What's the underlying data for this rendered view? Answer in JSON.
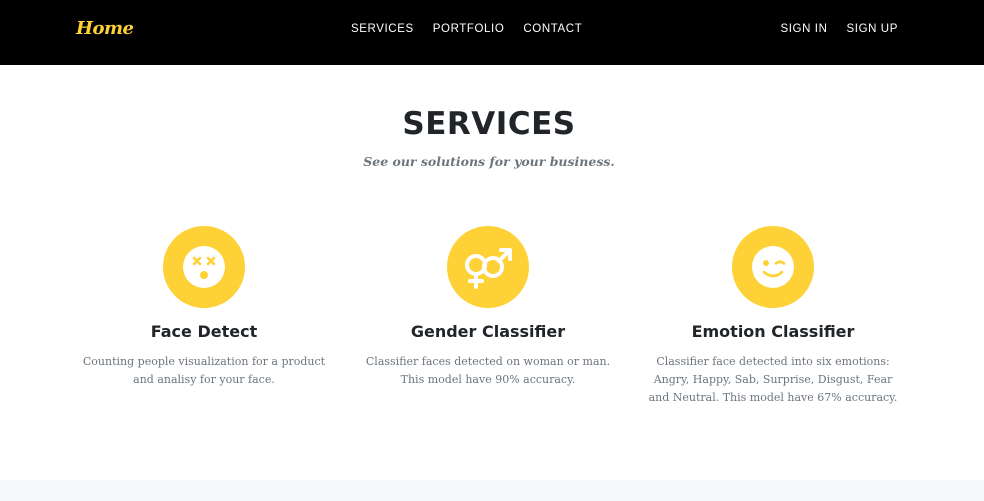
{
  "nav": {
    "brand": "Home",
    "center_links": [
      "SERVICES",
      "PORTFOLIO",
      "CONTACT"
    ],
    "right_links": [
      "SIGN IN",
      "SIGN UP"
    ]
  },
  "section": {
    "title": "SERVICES",
    "subtitle": "See our solutions for your business."
  },
  "services": [
    {
      "icon": "dizzy-face-icon",
      "title": "Face Detect",
      "description": "Counting people visualization for a product and analisy for your face."
    },
    {
      "icon": "gender-symbols-icon",
      "title": "Gender Classifier",
      "description": "Classifier faces detected on woman or man. This model have 90% accuracy."
    },
    {
      "icon": "wink-face-icon",
      "title": "Emotion Classifier",
      "description": "Classifier face detected into six emotions: Angry, Happy, Sab, Surprise, Disgust, Fear and Neutral. This model have 67% accuracy."
    }
  ],
  "colors": {
    "accent": "#fed136",
    "navbar": "#000000",
    "heading": "#212529",
    "muted": "#6c757d"
  }
}
